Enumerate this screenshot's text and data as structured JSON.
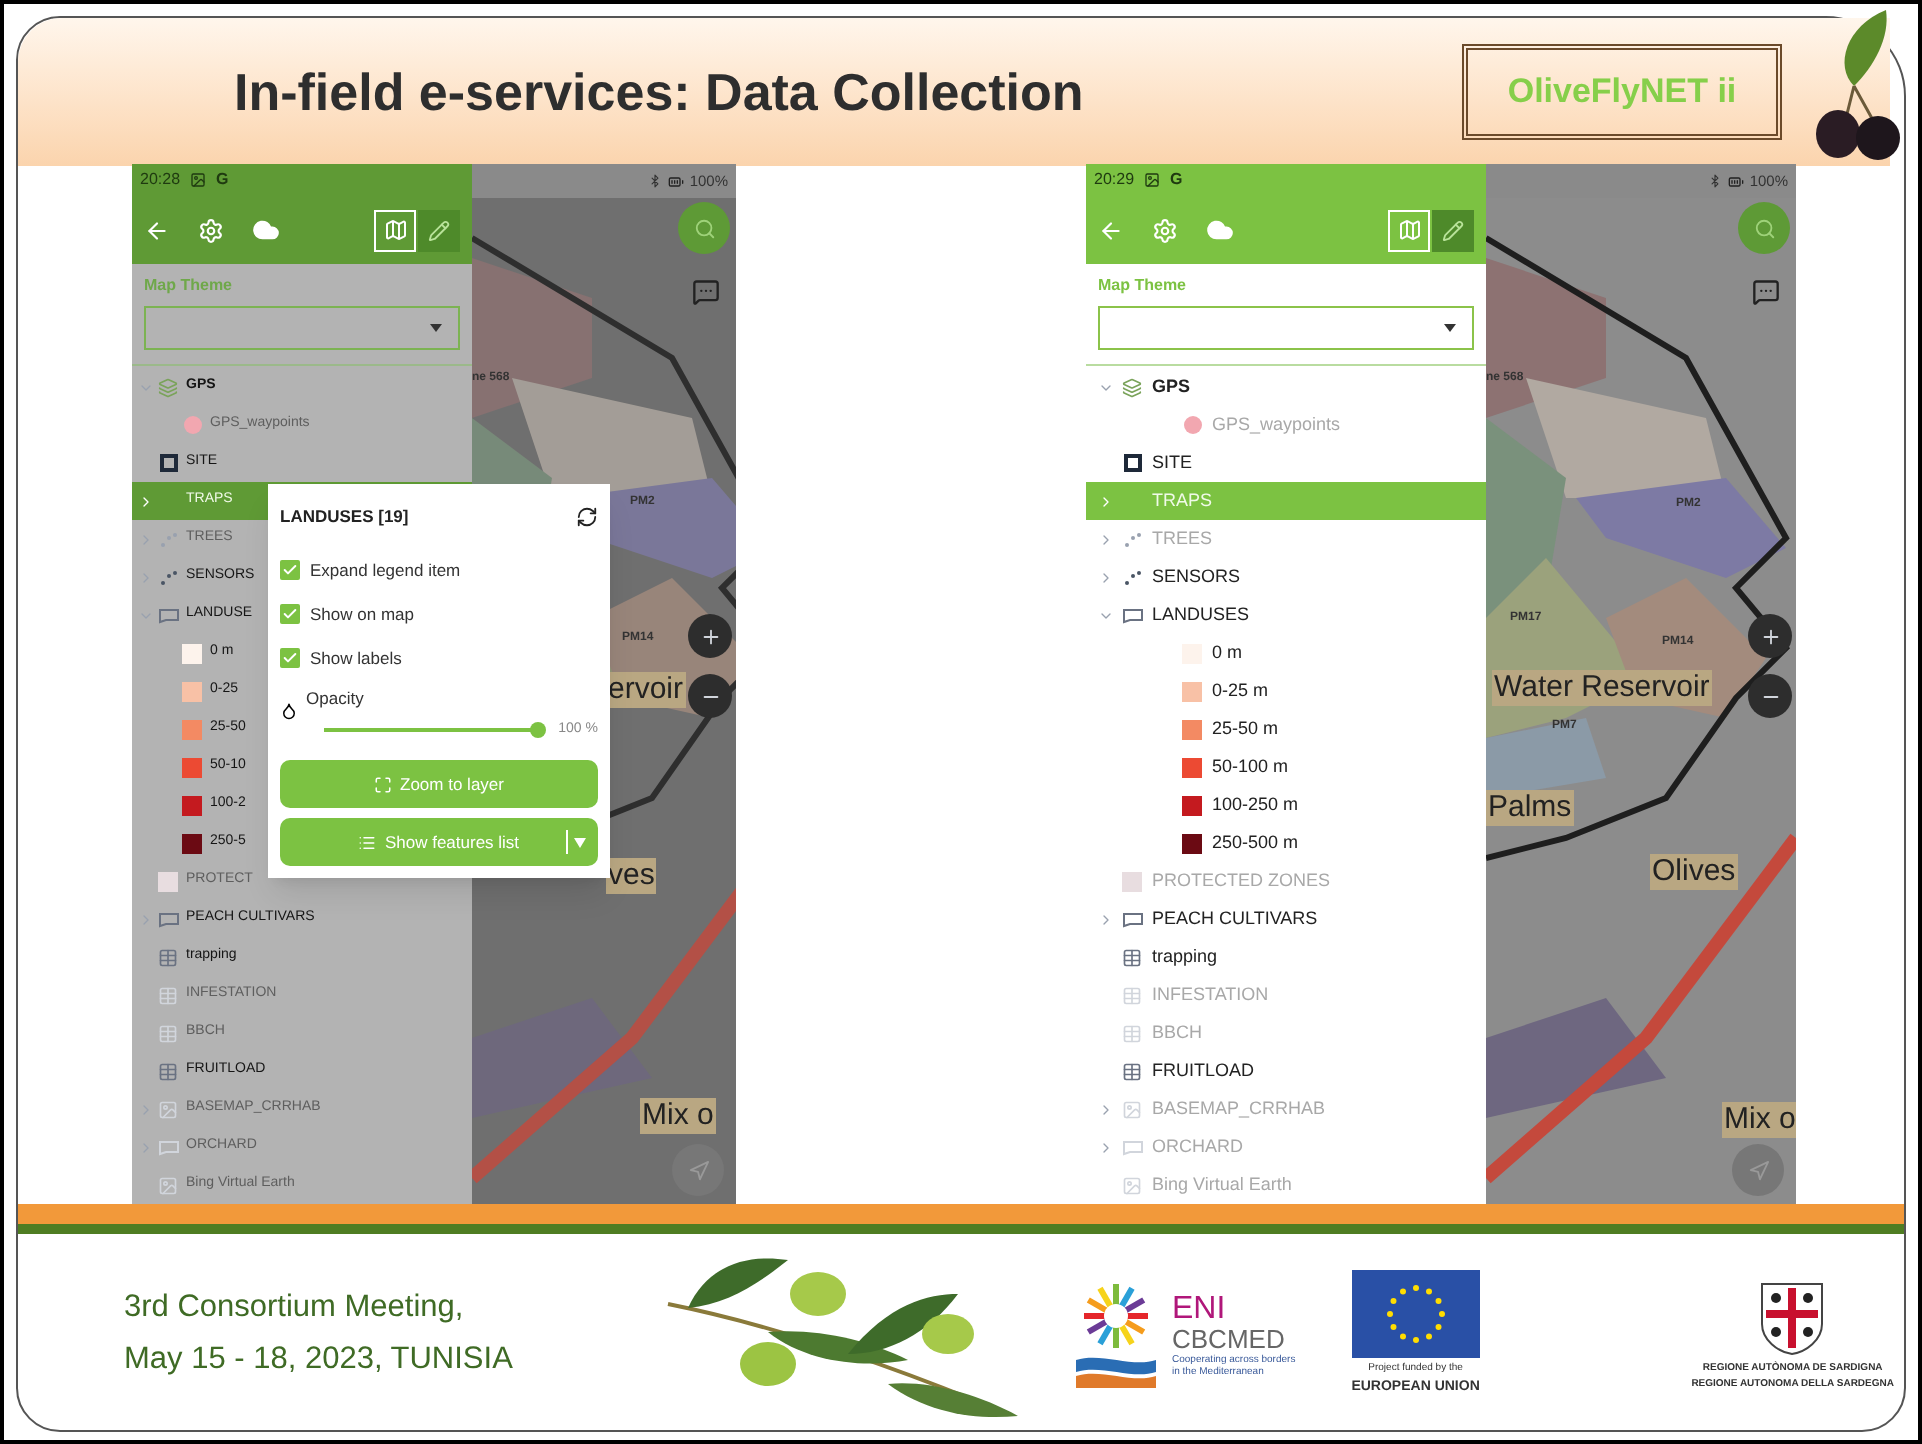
{
  "header": {
    "title": "In-field e-services: Data Collection",
    "logo": "OliveFlyNET ii"
  },
  "phones": [
    {
      "status": {
        "time": "20:28",
        "network": "G",
        "battery": "100%"
      },
      "toolbar": {
        "modes": [
          {
            "kind": "map",
            "selected": true
          },
          {
            "kind": "edit",
            "selected": false
          }
        ]
      },
      "map_theme": {
        "label": "Map Theme"
      },
      "layers": [
        {
          "name": "GPS",
          "kind": "layers",
          "expanded": true,
          "visible": true,
          "selected": false,
          "children": [
            {
              "name": "GPS_waypoints",
              "kind": "dot",
              "color": "#f2a7b0",
              "visible": false,
              "selected": false
            }
          ]
        },
        {
          "name": "SITE",
          "kind": "square",
          "visible": true,
          "selected": false
        },
        {
          "name": "TRAPS",
          "kind": "group",
          "expanded": false,
          "visible": false,
          "selected": true
        },
        {
          "name": "TREES",
          "kind": "dots",
          "expanded": false,
          "visible": false,
          "selected": false
        },
        {
          "name": "SENSORS",
          "kind": "dots",
          "expanded": false,
          "visible": true,
          "selected": false
        },
        {
          "name": "LANDUSE",
          "kind": "flag",
          "expanded": true,
          "visible": true,
          "selected": false,
          "children": [
            {
              "name": "0 m",
              "kind": "swatch",
              "color": "#fdf3ec",
              "visible": true,
              "selected": false
            },
            {
              "name": "0-25",
              "kind": "swatch",
              "color": "#f8c1a6",
              "visible": true,
              "selected": false
            },
            {
              "name": "25-50",
              "kind": "swatch",
              "color": "#f38a63",
              "visible": true,
              "selected": false
            },
            {
              "name": "50-10",
              "kind": "swatch",
              "color": "#ec4a33",
              "visible": true,
              "selected": false
            },
            {
              "name": "100-2",
              "kind": "swatch",
              "color": "#c41a1f",
              "visible": true,
              "selected": false
            },
            {
              "name": "250-5",
              "kind": "swatch",
              "color": "#6b0a13",
              "visible": true,
              "selected": false
            }
          ]
        },
        {
          "name": "PROTECT",
          "kind": "grid",
          "visible": false,
          "selected": false
        },
        {
          "name": "PEACH CULTIVARS",
          "kind": "flag",
          "expanded": false,
          "visible": true,
          "selected": false
        },
        {
          "name": "trapping",
          "kind": "table",
          "visible": true,
          "selected": false
        },
        {
          "name": "INFESTATION",
          "kind": "table",
          "visible": false,
          "selected": false
        },
        {
          "name": "BBCH",
          "kind": "table",
          "visible": false,
          "selected": false
        },
        {
          "name": "FRUITLOAD",
          "kind": "table",
          "visible": true,
          "selected": false
        },
        {
          "name": "BASEMAP_CRRHAB",
          "kind": "raster",
          "expanded": false,
          "visible": false,
          "selected": false
        },
        {
          "name": "ORCHARD",
          "kind": "flag",
          "expanded": false,
          "visible": false,
          "selected": false
        },
        {
          "name": "Bing Virtual Earth",
          "kind": "raster",
          "visible": false,
          "selected": false
        }
      ],
      "map": {
        "labels": [
          {
            "text": "ne 568",
            "kind": "area"
          },
          {
            "text": "PM2",
            "kind": "area"
          },
          {
            "text": "PM14",
            "kind": "area"
          },
          {
            "text": "ervoir",
            "kind": "place"
          },
          {
            "text": "ves",
            "kind": "place"
          },
          {
            "text": "Mix o",
            "kind": "place"
          }
        ]
      },
      "dialog": {
        "title": "LANDUSES [19]",
        "options": [
          {
            "label": "Expand legend item",
            "checked": true
          },
          {
            "label": "Show on map",
            "checked": true
          },
          {
            "label": "Show labels",
            "checked": true
          }
        ],
        "opacity": {
          "label": "Opacity",
          "level": 1.0,
          "reading": "100 %"
        },
        "buttons": [
          {
            "label": "Zoom to layer",
            "kind": "zoom"
          },
          {
            "label": "Show features list",
            "kind": "list"
          }
        ]
      }
    },
    {
      "status": {
        "time": "20:29",
        "network": "G",
        "battery": "100%"
      },
      "toolbar": {
        "modes": [
          {
            "kind": "map",
            "selected": true
          },
          {
            "kind": "edit",
            "selected": false
          }
        ]
      },
      "map_theme": {
        "label": "Map Theme"
      },
      "layers": [
        {
          "name": "GPS",
          "kind": "layers",
          "expanded": true,
          "visible": true,
          "selected": false,
          "children": [
            {
              "name": "GPS_waypoints",
              "kind": "dot",
              "color": "#f2a7b0",
              "visible": false,
              "selected": false
            }
          ]
        },
        {
          "name": "SITE",
          "kind": "square",
          "visible": true,
          "selected": false
        },
        {
          "name": "TRAPS",
          "kind": "group",
          "expanded": false,
          "visible": false,
          "selected": true
        },
        {
          "name": "TREES",
          "kind": "dots",
          "expanded": false,
          "visible": false,
          "selected": false
        },
        {
          "name": "SENSORS",
          "kind": "dots",
          "expanded": false,
          "visible": true,
          "selected": false
        },
        {
          "name": "LANDUSES",
          "kind": "flag",
          "expanded": true,
          "visible": true,
          "selected": false,
          "children": [
            {
              "name": "0 m",
              "kind": "swatch",
              "color": "#fdf3ec",
              "visible": true,
              "selected": false
            },
            {
              "name": "0-25 m",
              "kind": "swatch",
              "color": "#f8c1a6",
              "visible": true,
              "selected": false
            },
            {
              "name": "25-50 m",
              "kind": "swatch",
              "color": "#f38a63",
              "visible": true,
              "selected": false
            },
            {
              "name": "50-100 m",
              "kind": "swatch",
              "color": "#ec4a33",
              "visible": true,
              "selected": false
            },
            {
              "name": "100-250 m",
              "kind": "swatch",
              "color": "#c41a1f",
              "visible": true,
              "selected": false
            },
            {
              "name": "250-500 m",
              "kind": "swatch",
              "color": "#6b0a13",
              "visible": true,
              "selected": false
            }
          ]
        },
        {
          "name": "PROTECTED ZONES",
          "kind": "grid",
          "visible": false,
          "selected": false
        },
        {
          "name": "PEACH CULTIVARS",
          "kind": "flag",
          "expanded": false,
          "visible": true,
          "selected": false
        },
        {
          "name": "trapping",
          "kind": "table",
          "visible": true,
          "selected": false
        },
        {
          "name": "INFESTATION",
          "kind": "table",
          "visible": false,
          "selected": false
        },
        {
          "name": "BBCH",
          "kind": "table",
          "visible": false,
          "selected": false
        },
        {
          "name": "FRUITLOAD",
          "kind": "table",
          "visible": true,
          "selected": false
        },
        {
          "name": "BASEMAP_CRRHAB",
          "kind": "raster",
          "expanded": false,
          "visible": false,
          "selected": false
        },
        {
          "name": "ORCHARD",
          "kind": "flag",
          "expanded": false,
          "visible": false,
          "selected": false
        },
        {
          "name": "Bing Virtual Earth",
          "kind": "raster",
          "visible": false,
          "selected": false
        }
      ],
      "map": {
        "labels": [
          {
            "text": "ne 568",
            "kind": "area"
          },
          {
            "text": "PM2",
            "kind": "area"
          },
          {
            "text": "PM17",
            "kind": "area"
          },
          {
            "text": "PM14",
            "kind": "area"
          },
          {
            "text": "Water Reservoir",
            "kind": "place"
          },
          {
            "text": "PM7",
            "kind": "area"
          },
          {
            "text": "Palms",
            "kind": "place"
          },
          {
            "text": "Olives",
            "kind": "place"
          },
          {
            "text": "Mix o",
            "kind": "place"
          }
        ]
      }
    }
  ],
  "footer": {
    "meeting": [
      "3rd Consortium Meeting,",
      "May 15 - 18, 2023, TUNISIA"
    ],
    "eni": {
      "name": "ENI",
      "program": "CBCMED",
      "tagline": [
        "Cooperating across borders",
        "in the Mediterranean"
      ]
    },
    "eu": {
      "caption": "Project funded by the",
      "name": "EUROPEAN UNION"
    },
    "region": [
      "REGIONE AUTÒNOMA DE SARDIGNA",
      "REGIONE AUTONOMA DELLA SARDEGNA"
    ]
  }
}
